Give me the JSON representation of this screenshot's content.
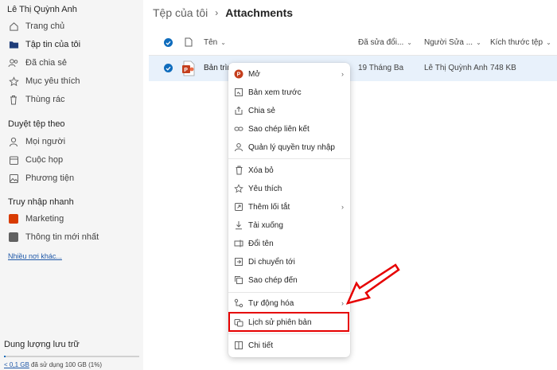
{
  "sidebar": {
    "user_name": "Lê Thị Quỳnh Anh",
    "nav": [
      {
        "label": "Trang chủ",
        "icon": "home-icon"
      },
      {
        "label": "Tập tin của tôi",
        "icon": "folder-icon"
      },
      {
        "label": "Đã chia sẻ",
        "icon": "people-icon"
      },
      {
        "label": "Mục yêu thích",
        "icon": "star-icon"
      },
      {
        "label": "Thùng rác",
        "icon": "trash-icon"
      }
    ],
    "browse_title": "Duyệt tệp theo",
    "browse": [
      {
        "label": "Mọi người",
        "icon": "person-icon"
      },
      {
        "label": "Cuộc họp",
        "icon": "calendar-icon"
      },
      {
        "label": "Phương tiện",
        "icon": "image-icon"
      }
    ],
    "quick_title": "Truy nhập nhanh",
    "quick": [
      {
        "label": "Marketing",
        "icon": "site-icon"
      },
      {
        "label": "Thông tin mới nhất",
        "icon": "site-icon"
      }
    ],
    "more_link": "Nhiều nơi khác...",
    "storage": {
      "title": "Dung lượng lưu trữ",
      "used_link": "< 0,1 GB",
      "used_text": "đã sử dụng 100 GB (1%)",
      "percent": 1
    }
  },
  "header": {
    "root": "Tệp của tôi",
    "current": "Attachments"
  },
  "table": {
    "columns": [
      "Tên",
      "Đã sửa đổi...",
      "Người Sửa ...",
      "Kích thước tệp"
    ],
    "rows": [
      {
        "name": "Bản trình",
        "modified": "19 Tháng Ba",
        "modified_by": "Lê Thị Quỳnh Anh",
        "size": "748 KB",
        "selected": true
      }
    ]
  },
  "context_menu": {
    "items": [
      {
        "label": "Mở",
        "icon": "powerpoint-icon",
        "submenu": true
      },
      {
        "label": "Bản xem trước",
        "icon": "preview-icon"
      },
      {
        "label": "Chia sẻ",
        "icon": "share-icon"
      },
      {
        "label": "Sao chép liên kết",
        "icon": "link-icon"
      },
      {
        "label": "Quản lý quyền truy nhập",
        "icon": "person-access-icon"
      },
      {
        "label": "Xóa bỏ",
        "icon": "trash-icon"
      },
      {
        "label": "Yêu thích",
        "icon": "star-icon"
      },
      {
        "label": "Thêm lối tắt",
        "icon": "shortcut-icon",
        "submenu": true
      },
      {
        "label": "Tải xuống",
        "icon": "download-icon"
      },
      {
        "label": "Đổi tên",
        "icon": "rename-icon"
      },
      {
        "label": "Di chuyển tới",
        "icon": "move-icon"
      },
      {
        "label": "Sao chép đến",
        "icon": "copy-icon"
      },
      {
        "label": "Tự động hóa",
        "icon": "automate-icon",
        "submenu": true
      },
      {
        "label": "Lịch sử phiên bản",
        "icon": "version-history-icon",
        "highlighted": true
      },
      {
        "label": "Chi tiết",
        "icon": "details-icon"
      }
    ]
  },
  "colors": {
    "accent": "#0f6cbd",
    "highlight": "#e60000",
    "selected_row": "#e8f1fb",
    "sidebar_bg": "#f5f5f5"
  }
}
